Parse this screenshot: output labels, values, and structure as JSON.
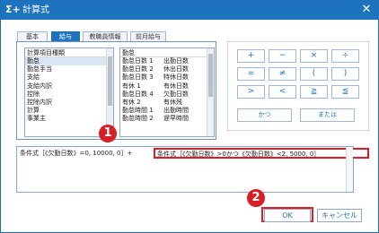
{
  "window": {
    "title": "計算式",
    "title_icon": "Σ+",
    "close": "✕"
  },
  "tabs": [
    "基本",
    "給与",
    "教職員情報",
    "前月給与"
  ],
  "active_tab": 1,
  "list1": {
    "header": "計算項目種類",
    "items": [
      "勤怠",
      "勤怠手当",
      "支給",
      "支給内訳",
      "控除",
      "控除内訳",
      "計算",
      "事業主"
    ],
    "selected": 0
  },
  "list2": {
    "header": "勤怠",
    "items": [
      [
        "勤怠日数 1",
        "出勤日数"
      ],
      [
        "勤怠日数 2",
        "休出日数"
      ],
      [
        "勤怠日数 3",
        "特休日数"
      ],
      [
        "有休 1",
        "有休日数"
      ],
      [
        "勤怠日数 4",
        "欠勤日数"
      ],
      [
        "有休 2",
        "有休残"
      ],
      [
        "勤怠時間 1",
        "出勤時間"
      ],
      [
        "勤怠時間 2",
        "遅早時間"
      ]
    ]
  },
  "operators": [
    "+",
    "−",
    "×",
    "÷",
    "=",
    "≠",
    "(",
    ")",
    ">",
    "<",
    "≧",
    "≦"
  ],
  "op_and": "かつ",
  "op_or": "または",
  "formula": {
    "left_text": "条件式［《欠勤日数》=0, 10000, 0］+",
    "highlight_text": "条件式［《欠勤日数》>0かつ《欠勤日数》<2, 5000, 0］"
  },
  "badges": [
    "1",
    "2"
  ],
  "buttons": {
    "ok": "OK",
    "cancel": "キャンセル"
  },
  "colors": {
    "accent": "#1e73be",
    "callout": "#d81f26"
  }
}
